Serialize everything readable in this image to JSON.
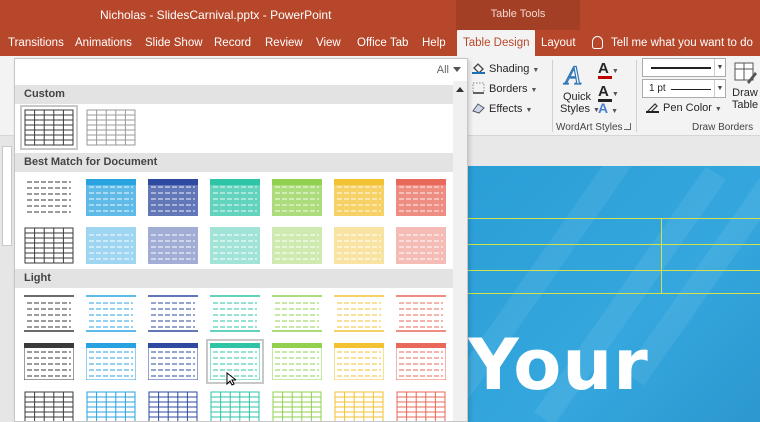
{
  "window": {
    "title": "Nicholas - SlidesCarnival.pptx  -  PowerPoint",
    "context_tab_group": "Table Tools"
  },
  "tabs": [
    {
      "label": "Transitions"
    },
    {
      "label": "Animations"
    },
    {
      "label": "Slide Show"
    },
    {
      "label": "Record"
    },
    {
      "label": "Review"
    },
    {
      "label": "View"
    },
    {
      "label": "Office Tab"
    },
    {
      "label": "Help"
    },
    {
      "label": "Table Design",
      "active": true
    },
    {
      "label": "Layout"
    }
  ],
  "tell_me": "Tell me what you want to do",
  "ribbon": {
    "shading": "Shading",
    "borders": "Borders",
    "effects": "Effects",
    "quick_styles_1": "Quick",
    "quick_styles_2": "Styles",
    "wordart_group": "WordArt Styles",
    "pen_weight": "1 pt",
    "pen_color": "Pen Color",
    "draw_table_1": "Draw",
    "draw_table_2": "Table",
    "draw_borders_group": "Draw Borders"
  },
  "gallery": {
    "filter_label": "All",
    "sections": {
      "custom": "Custom",
      "best_match": "Best Match for Document",
      "light": "Light"
    },
    "colors": {
      "black": "#3a3a3a",
      "gray": "#9a9a9a",
      "sky": "#29a3e0",
      "navy": "#2e4aa0",
      "teal": "#2ec4a6",
      "lime": "#92d050",
      "gold": "#f2c233",
      "salmon": "#e8685a"
    }
  },
  "slide": {
    "visible_text": "Your"
  }
}
